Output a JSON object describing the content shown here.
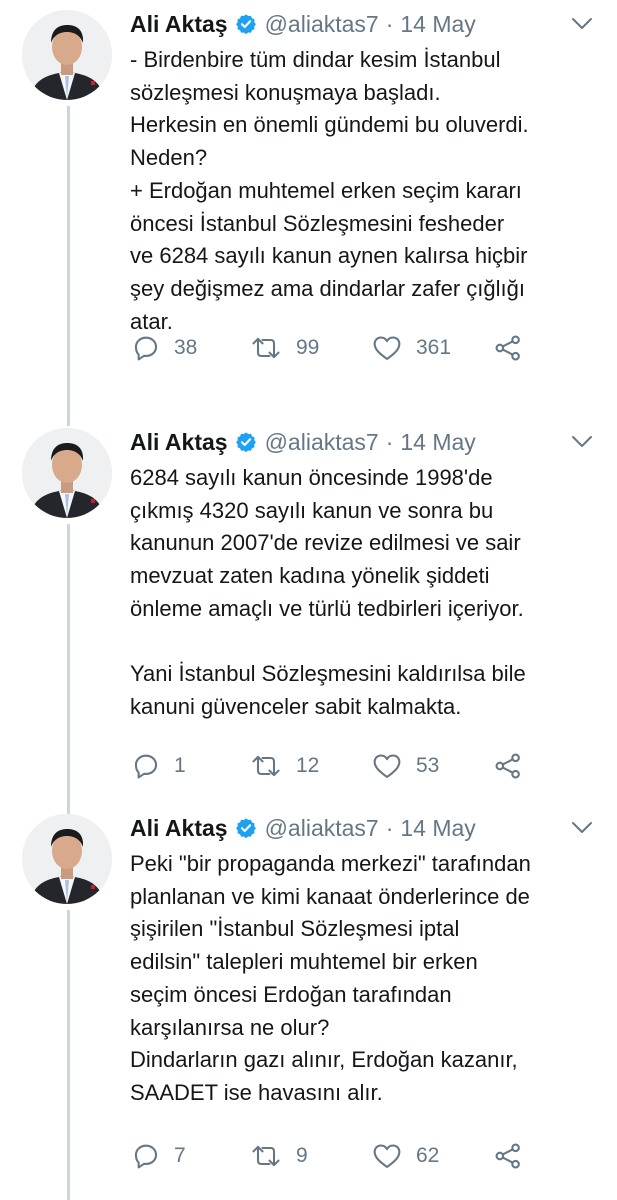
{
  "tweets": [
    {
      "author": {
        "name": "Ali Aktaş",
        "handle": "@aliaktas7"
      },
      "separator": "·",
      "date": "14 May",
      "text_lines": [
        "- Birdenbire tüm dindar kesim İstanbul",
        "sözleşmesi konuşmaya başladı.",
        "Herkesin en önemli gündemi bu oluverdi.",
        "Neden?",
        "+ Erdoğan muhtemel erken seçim kararı",
        "öncesi İstanbul Sözleşmesini fesheder",
        "ve 6284 sayılı kanun aynen kalırsa hiçbir",
        "şey değişmez ama dindarlar zafer çığlığı",
        "atar."
      ],
      "replies": "38",
      "retweets": "99",
      "likes": "361"
    },
    {
      "author": {
        "name": "Ali Aktaş",
        "handle": "@aliaktas7"
      },
      "separator": "·",
      "date": "14 May",
      "text_lines": [
        "6284 sayılı kanun öncesinde 1998'de",
        "çıkmış 4320 sayılı kanun ve sonra bu",
        "kanunun 2007'de revize edilmesi ve sair",
        "mevzuat zaten kadına yönelik şiddeti",
        "önleme amaçlı ve türlü tedbirleri içeriyor.",
        "",
        "Yani İstanbul Sözleşmesini kaldırılsa bile",
        "kanuni güvenceler sabit kalmakta."
      ],
      "replies": "1",
      "retweets": "12",
      "likes": "53"
    },
    {
      "author": {
        "name": "Ali Aktaş",
        "handle": "@aliaktas7"
      },
      "separator": "·",
      "date": "14 May",
      "text_lines": [
        "Peki \"bir propaganda merkezi\" tarafından",
        "planlanan ve kimi kanaat önderlerince de",
        "şişirilen \"İstanbul Sözleşmesi iptal",
        "edilsin\" talepleri muhtemel bir erken",
        "seçim öncesi Erdoğan tarafından",
        "karşılanırsa ne olur?",
        "Dindarların gazı alınır, Erdoğan kazanır,",
        "SAADET ise havasını alır."
      ],
      "replies": "7",
      "retweets": "9",
      "likes": "62"
    }
  ],
  "icons": {
    "verified": "verified-badge-icon",
    "menu": "chevron-down-icon",
    "reply": "reply-icon",
    "retweet": "retweet-icon",
    "like": "heart-icon",
    "share": "share-icon"
  },
  "colors": {
    "text": "#14171a",
    "secondary": "#657786",
    "verified": "#1da1f2",
    "thread_line": "#ccd6dd",
    "icon": "#657786"
  }
}
